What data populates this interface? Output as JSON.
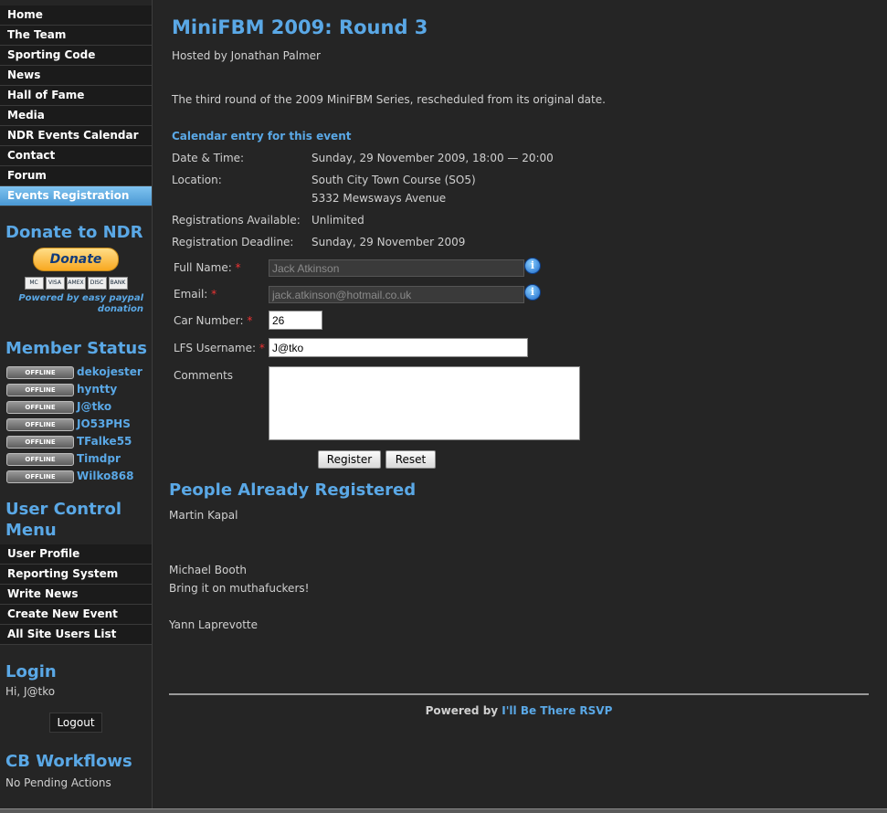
{
  "nav": [
    "Home",
    "The Team",
    "Sporting Code",
    "News",
    "Hall of Fame",
    "Media",
    "NDR Events Calendar",
    "Contact",
    "Forum",
    "Events Registration"
  ],
  "donate": {
    "title": "Donate to NDR",
    "button": "Donate",
    "cards": [
      "MC",
      "VISA",
      "AMEX",
      "DISC",
      "BANK"
    ],
    "powered_line1": "Powered by easy paypal",
    "powered_line2": "donation"
  },
  "member_status": {
    "title": "Member Status",
    "badge": "OFFLINE",
    "members": [
      "dekojester",
      "hyntty",
      "J@tko",
      "JO53PHS",
      "TFalke55",
      "Timdpr",
      "Wilko868"
    ]
  },
  "user_menu": {
    "title_line1": "User Control",
    "title_line2": "Menu",
    "items": [
      "User Profile",
      "Reporting System",
      "Write News",
      "Create New Event",
      "All Site Users List"
    ]
  },
  "login": {
    "title": "Login",
    "greeting": "Hi, J@tko",
    "logout": "Logout"
  },
  "workflows": {
    "title": "CB Workflows",
    "text": "No Pending Actions"
  },
  "event": {
    "title": "MiniFBM 2009: Round 3",
    "host": "Hosted by Jonathan Palmer",
    "description": "The third round of the 2009 MiniFBM Series, rescheduled from its original date.",
    "calendar_link": "Calendar entry for this event",
    "details": [
      {
        "label": "Date & Time:",
        "value": "Sunday, 29 November 2009, 18:00 — 20:00"
      },
      {
        "label": "Location:",
        "value": "South City Town Course (SO5)",
        "value2": "5332 Mewsways Avenue"
      },
      {
        "label": "Registrations Available:",
        "value": "Unlimited"
      },
      {
        "label": "Registration Deadline:",
        "value": "Sunday, 29 November 2009"
      }
    ]
  },
  "form": {
    "full_name_label": "Full Name:",
    "full_name_value": "Jack Atkinson",
    "email_label": "Email:",
    "email_value": "jack.atkinson@hotmail.co.uk",
    "car_label": "Car Number:",
    "car_value": "26",
    "lfs_label": "LFS Username:",
    "lfs_value": "J@tko",
    "comments_label": "Comments",
    "required_mark": "*",
    "register": "Register",
    "reset": "Reset"
  },
  "registered": {
    "title": "People Already Registered",
    "people": [
      {
        "name": "Martin Kapal",
        "comment": ""
      },
      {
        "name": "Michael Booth",
        "comment": "Bring it on muthafuckers!"
      },
      {
        "name": "Yann Laprevotte",
        "comment": ""
      }
    ]
  },
  "footer": {
    "prefix": "Powered by ",
    "link": "I'll Be There RSVP"
  }
}
